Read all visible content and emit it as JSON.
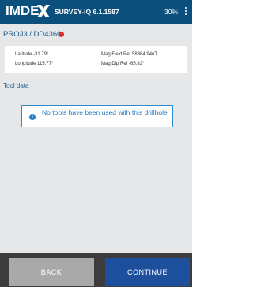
{
  "header": {
    "logo_text": "IMDEX",
    "app_name": "SURVEY-IQ 6.1.1587",
    "battery": "30%"
  },
  "drillhole": {
    "title": "PROJ3 / DD4360"
  },
  "coords": {
    "latitude": "Latitude  -31.79°",
    "longitude": "Longitude  115.77°",
    "mag_field": "Mag Field Ref  58364.94nT",
    "mag_dip": "Mag Dip Ref  -65.82°"
  },
  "tool_data": {
    "label": "Tool data",
    "notice": "No tools have been used with this drillhole"
  },
  "buttons": {
    "back": "BACK",
    "continue": "CONTINUE"
  },
  "colors": {
    "header_bg": "#0b4f7c",
    "accent": "#2b8ad1",
    "status_red": "#e02b2b",
    "continue_bg": "#1e4f9c",
    "back_bg": "#a9a9a9"
  }
}
